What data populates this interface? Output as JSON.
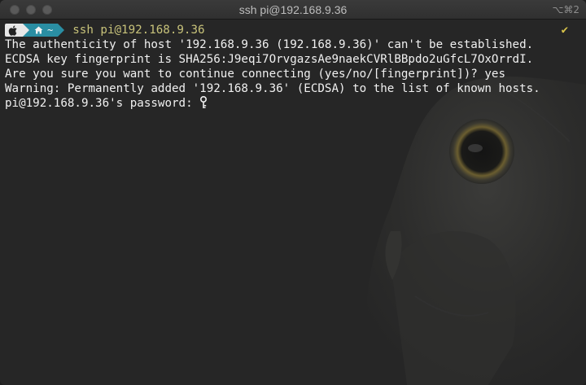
{
  "window": {
    "title": "ssh pi@192.168.9.36",
    "shortcut": "⌥⌘2"
  },
  "prompt": {
    "dir_label": "~",
    "command": "ssh pi@192.168.9.36",
    "status_glyph": "✔"
  },
  "output": {
    "lines": [
      "The authenticity of host '192.168.9.36 (192.168.9.36)' can't be established.",
      "ECDSA key fingerprint is SHA256:J9eqi7OrvgazsAe9naekCVRlBBpdo2uGfcL7OxOrrdI.",
      "Are you sure you want to continue connecting (yes/no/[fingerprint])? yes",
      "Warning: Permanently added '192.168.9.36' (ECDSA) to the list of known hosts."
    ],
    "password_prompt": "pi@192.168.9.36's password: "
  },
  "colors": {
    "apple_segment": "#e8e8e8",
    "dir_segment": "#2a8ea3",
    "command_text": "#c7c27a",
    "status_check": "#d9c44a",
    "terminal_bg": "#262626"
  },
  "icons": {
    "apple": "apple-icon",
    "home": "home-icon",
    "key_cursor": "key-icon"
  }
}
